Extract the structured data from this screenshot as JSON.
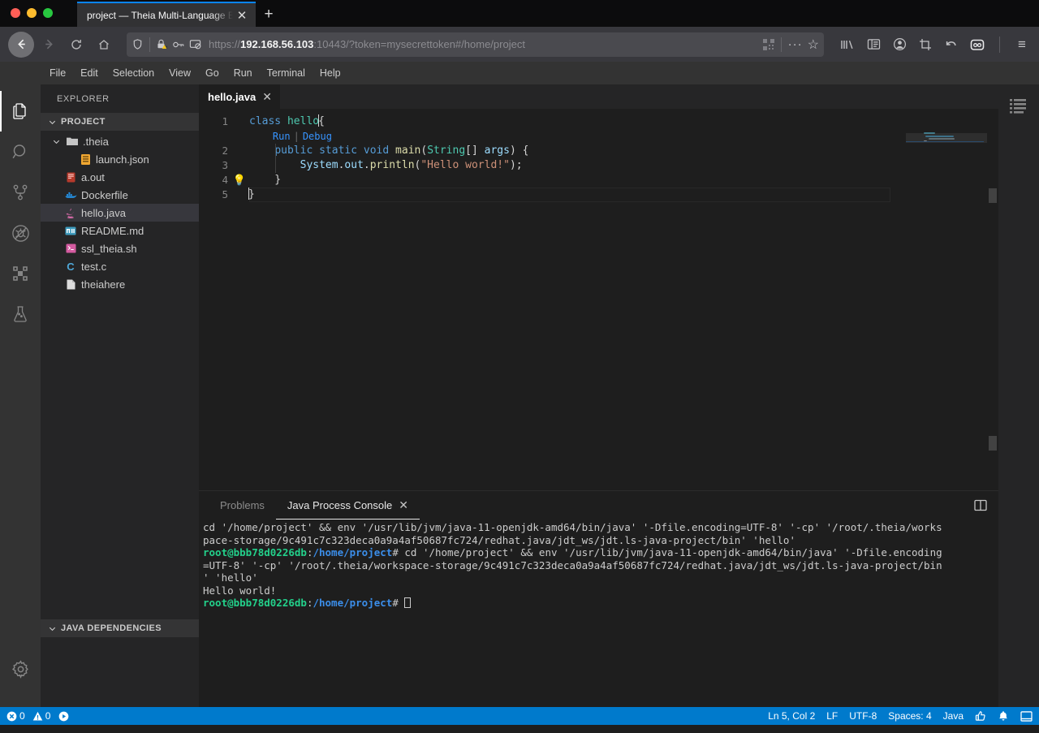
{
  "browser": {
    "tab_title": "project — Theia Multi-Language Exa",
    "tab_close_glyph": "✕",
    "new_tab_glyph": "+",
    "url": {
      "scheme": "https://",
      "host": "192.168.56.103",
      "rest": ":10443/?token=mysecrettoken#/home/project"
    },
    "nav": {
      "back_glyph": "←",
      "forward_glyph": "→",
      "reload_glyph": "⟳",
      "home_glyph": "⌂"
    },
    "icons": {
      "shield": "shield-icon",
      "lock_warning": "lock-warning-icon",
      "permissions": "permissions-icon",
      "tracking_blocked": "tracking-blocked-icon",
      "qr": "qr-icon",
      "more": "···",
      "bookmark": "☆",
      "library": "library-icon",
      "sidebar": "sidebar-icon",
      "account": "account-icon",
      "screenshot": "screenshot-icon",
      "undo": "undo-icon",
      "container": "container-icon",
      "menu": "≡"
    }
  },
  "menubar": {
    "items": [
      "File",
      "Edit",
      "Selection",
      "View",
      "Go",
      "Run",
      "Terminal",
      "Help"
    ]
  },
  "activitybar": {
    "items": [
      {
        "name": "explorer",
        "icon": "files-icon",
        "active": true
      },
      {
        "name": "search",
        "icon": "search-icon",
        "active": false
      },
      {
        "name": "source-control",
        "icon": "source-control-icon",
        "active": false
      },
      {
        "name": "debug",
        "icon": "debug-disabled-icon",
        "active": false
      },
      {
        "name": "extensions",
        "icon": "extensions-icon",
        "active": false
      },
      {
        "name": "testing",
        "icon": "beaker-icon",
        "active": false
      }
    ],
    "settings_icon": "gear-icon"
  },
  "sidebar": {
    "title": "EXPLORER",
    "project_section": "PROJECT",
    "bottom_section": "JAVA DEPENDENCIES",
    "chevron": "⌄",
    "tree": [
      {
        "label": ".theia",
        "icon": "folder-icon",
        "depth": 1,
        "color": "#c5c5c5",
        "glyph": "▰",
        "selected": false,
        "expandable": true
      },
      {
        "label": "launch.json",
        "icon": "json-icon",
        "depth": 2,
        "color": "#f0a732",
        "glyph": "▤",
        "selected": false,
        "expandable": false
      },
      {
        "label": "a.out",
        "icon": "binary-icon",
        "depth": 1,
        "color": "#c74e39",
        "glyph": "▤",
        "selected": false,
        "expandable": false
      },
      {
        "label": "Dockerfile",
        "icon": "docker-icon",
        "depth": 1,
        "color": "#2496ed",
        "glyph": "🐳",
        "selected": false,
        "expandable": false
      },
      {
        "label": "hello.java",
        "icon": "java-icon",
        "depth": 1,
        "color": "#d46ba8",
        "glyph": "☕",
        "selected": true,
        "expandable": false
      },
      {
        "label": "README.md",
        "icon": "markdown-icon",
        "depth": 1,
        "color": "#42a5c4",
        "glyph": "▤",
        "selected": false,
        "expandable": false
      },
      {
        "label": "ssl_theia.sh",
        "icon": "shell-icon",
        "depth": 1,
        "color": "#d45ba0",
        "glyph": "▣",
        "selected": false,
        "expandable": false
      },
      {
        "label": "test.c",
        "icon": "c-icon",
        "depth": 1,
        "color": "#4fa8d8",
        "glyph": "C",
        "selected": false,
        "expandable": false
      },
      {
        "label": "theiahere",
        "icon": "file-icon",
        "depth": 1,
        "color": "#d8d8d8",
        "glyph": "▯",
        "selected": false,
        "expandable": false
      }
    ]
  },
  "editor": {
    "tab_label": "hello.java",
    "tab_close_glyph": "✕",
    "line_numbers": [
      "1",
      "2",
      "3",
      "4",
      "5"
    ],
    "codelens": {
      "run": "Run",
      "separator": "|",
      "debug": "Debug"
    },
    "bulb_glyph": "💡",
    "lines": [
      {
        "n": 1,
        "tokens": [
          {
            "t": "class ",
            "c": "kw"
          },
          {
            "t": "hello",
            "c": "typ"
          },
          {
            "t": "{",
            "c": "plain"
          }
        ]
      },
      {
        "n": 2,
        "tokens": [
          {
            "t": "    ",
            "c": "plain"
          },
          {
            "t": "public ",
            "c": "kw"
          },
          {
            "t": "static ",
            "c": "kw"
          },
          {
            "t": "void ",
            "c": "kw"
          },
          {
            "t": "main",
            "c": "fn"
          },
          {
            "t": "(",
            "c": "plain"
          },
          {
            "t": "String",
            "c": "typ"
          },
          {
            "t": "[] ",
            "c": "plain"
          },
          {
            "t": "args",
            "c": "id"
          },
          {
            "t": ") {",
            "c": "plain"
          }
        ]
      },
      {
        "n": 3,
        "tokens": [
          {
            "t": "        ",
            "c": "plain"
          },
          {
            "t": "System",
            "c": "id"
          },
          {
            "t": ".",
            "c": "plain"
          },
          {
            "t": "out",
            "c": "id"
          },
          {
            "t": ".",
            "c": "plain"
          },
          {
            "t": "println",
            "c": "fn"
          },
          {
            "t": "(",
            "c": "plain"
          },
          {
            "t": "\"Hello world!\"",
            "c": "str"
          },
          {
            "t": ");",
            "c": "plain"
          }
        ]
      },
      {
        "n": 4,
        "tokens": [
          {
            "t": "    }",
            "c": "plain"
          }
        ]
      },
      {
        "n": 5,
        "tokens": [
          {
            "t": "}",
            "c": "plain"
          }
        ]
      }
    ],
    "outline_icon": "outline-icon"
  },
  "panel": {
    "tabs": [
      {
        "label": "Problems",
        "active": false,
        "closable": false
      },
      {
        "label": "Java Process Console",
        "active": true,
        "closable": true
      }
    ],
    "close_glyph": "✕",
    "split_icon": "split-panel-icon",
    "terminal_lines": [
      {
        "type": "plain",
        "text": "cd '/home/project' && env '/usr/lib/jvm/java-11-openjdk-amd64/bin/java' '-Dfile.encoding=UTF-8' '-cp' '/root/.theia/works"
      },
      {
        "type": "plain",
        "text": "pace-storage/9c491c7c323deca0a9a4af50687fc724/redhat.java/jdt_ws/jdt.ls-java-project/bin' 'hello'"
      },
      {
        "type": "prompt",
        "user": "root@bbb78d0226db",
        "colon": ":",
        "path": "/home/project",
        "tail": "# cd '/home/project' && env '/usr/lib/jvm/java-11-openjdk-amd64/bin/java' '-Dfile.encoding"
      },
      {
        "type": "plain",
        "text": "=UTF-8' '-cp' '/root/.theia/workspace-storage/9c491c7c323deca0a9a4af50687fc724/redhat.java/jdt_ws/jdt.ls-java-project/bin"
      },
      {
        "type": "plain",
        "text": "' 'hello'"
      },
      {
        "type": "plain",
        "text": "Hello world!"
      },
      {
        "type": "prompt",
        "user": "root@bbb78d0226db",
        "colon": ":",
        "path": "/home/project",
        "tail": "# ",
        "cursor": true
      }
    ]
  },
  "statusbar": {
    "errors": "0",
    "warnings": "0",
    "error_icon": "error-icon",
    "warning_icon": "warning-icon",
    "run_icon": "run-icon",
    "position": "Ln 5, Col 2",
    "eol": "LF",
    "encoding": "UTF-8",
    "indent": "Spaces: 4",
    "language": "Java",
    "feedback_icon": "thumbs-up-icon",
    "notifications_icon": "bell-icon",
    "layout_icon": "layout-icon",
    "background": "#007acc"
  }
}
